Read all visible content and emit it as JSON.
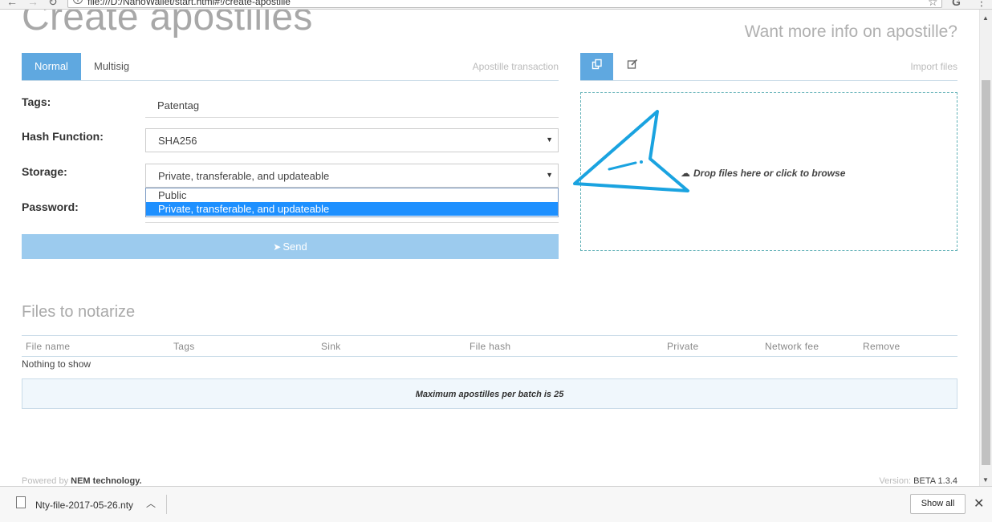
{
  "browser": {
    "url": "file:///D:/NanoWallet/start.html#!/create-apostille"
  },
  "page": {
    "title": "Create apostilles",
    "more_info": "Want more info on apostille?"
  },
  "left_tabs": {
    "normal": "Normal",
    "multisig": "Multisig",
    "right_label": "Apostille transaction"
  },
  "form": {
    "tags_label": "Tags:",
    "tags_value": "Patentag",
    "hash_label": "Hash Function:",
    "hash_value": "SHA256",
    "storage_label": "Storage:",
    "storage_value": "Private, transferable, and updateable",
    "storage_options": [
      "Public",
      "Private, transferable, and updateable"
    ],
    "password_label": "Password:",
    "send_label": "Send"
  },
  "right_tabs": {
    "right_label": "Import files"
  },
  "dropzone": {
    "text": "Drop files here or click to browse"
  },
  "files": {
    "title": "Files to notarize",
    "columns": [
      "File name",
      "Tags",
      "Sink",
      "File hash",
      "Private",
      "Network fee",
      "Remove"
    ],
    "empty_text": "Nothing to show",
    "max_notice": "Maximum apostilles per batch is 25"
  },
  "footer": {
    "powered_prefix": "Powered by",
    "powered_brand": "NEM technology.",
    "version_prefix": "Version:",
    "version_value": "BETA 1.3.4"
  },
  "download_bar": {
    "file_name": "Nty-file-2017-05-26.nty",
    "show_all": "Show all"
  },
  "colors": {
    "accent": "#5fa8e0",
    "send_button": "#9ccbee",
    "annotation": "#1aa3e0",
    "dropzone_border": "#5fb0b6"
  }
}
